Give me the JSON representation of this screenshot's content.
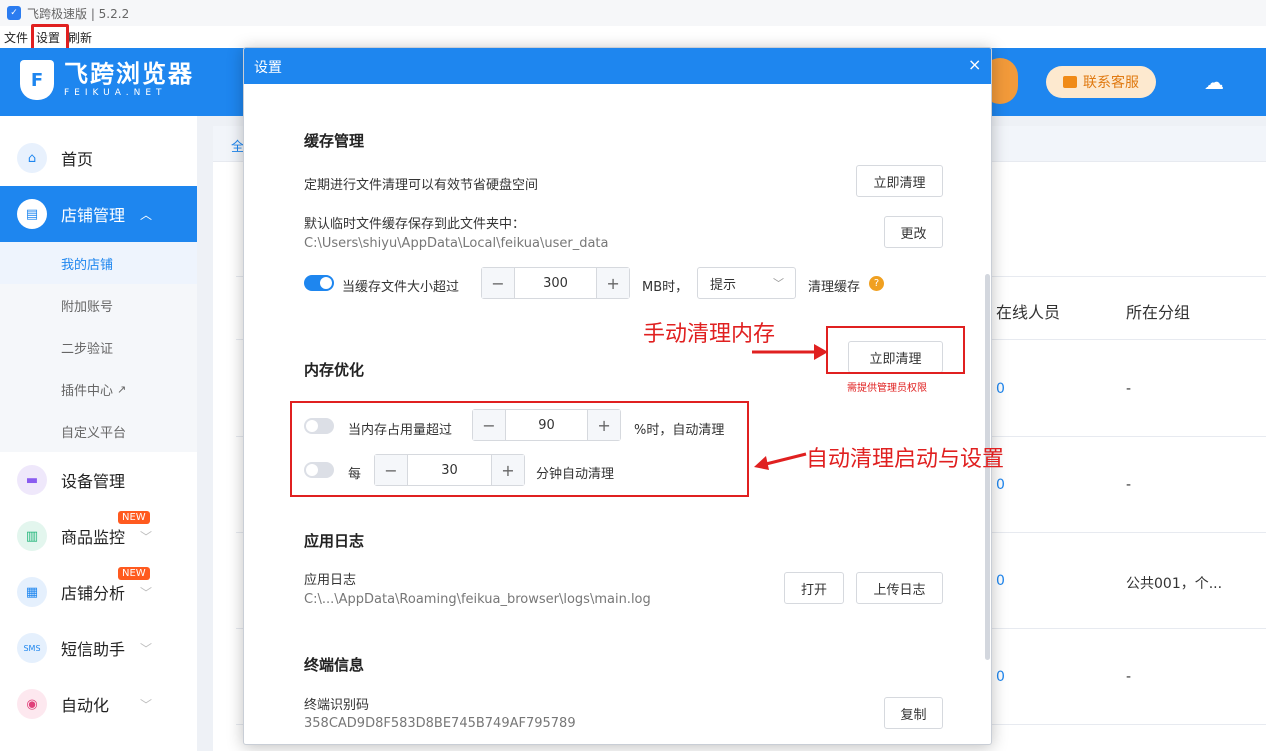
{
  "window": {
    "title": "飞跨极速版 | 5.2.2"
  },
  "menu": [
    "文件",
    "设置",
    "刷新"
  ],
  "brand": {
    "name": "飞跨浏览器",
    "sub": "FEIKUA.NET"
  },
  "header": {
    "service": "联系客服"
  },
  "sidebar": {
    "home": "首页",
    "shop": "店铺管理",
    "shop_sub": [
      "我的店铺",
      "附加账号",
      "二步验证",
      "插件中心",
      "自定义平台"
    ],
    "device": "设备管理",
    "monitor": "商品监控",
    "analysis": "店铺分析",
    "sms": "短信助手",
    "auto": "自动化",
    "new_badge": "NEW"
  },
  "background": {
    "tab": "全",
    "columns": [
      "在线人员",
      "所在分组"
    ],
    "rows": [
      {
        "online": "0",
        "group": "-"
      },
      {
        "online": "0",
        "group": "-"
      },
      {
        "online": "0",
        "group": "公共001，个..."
      },
      {
        "online": "0",
        "group": "-"
      }
    ]
  },
  "dialog": {
    "title": "设置",
    "close": "×",
    "cache": {
      "title": "缓存管理",
      "periodic": "定期进行文件清理可以有效节省硬盘空间",
      "clean_btn": "立即清理",
      "default_dir_label": "默认临时文件缓存保存到此文件夹中：",
      "default_dir_path": "C:\\Users\\shiyu\\AppData\\Local\\feikua\\user_data",
      "change_btn": "更改",
      "size_label": "当缓存文件大小超过",
      "size_value": "300",
      "size_unit": "MB时，",
      "action_select": "提示",
      "action_label": "清理缓存",
      "help": "?"
    },
    "memory": {
      "title": "内存优化",
      "clean_btn": "立即清理",
      "admin_note": "需提供管理员权限",
      "usage_label": "当内存占用量超过",
      "usage_value": "90",
      "usage_suffix": "%时，自动清理",
      "every_label": "每",
      "every_value": "30",
      "every_suffix": "分钟自动清理"
    },
    "log": {
      "title": "应用日志",
      "label": "应用日志",
      "path": "C:\\...\\AppData\\Roaming\\feikua_browser\\logs\\main.log",
      "open_btn": "打开",
      "upload_btn": "上传日志"
    },
    "terminal": {
      "title": "终端信息",
      "label": "终端识别码",
      "code": "358CAD9D8F583D8BE745B749AF795789",
      "copy_btn": "复制"
    }
  },
  "annotations": {
    "manual": "手动清理内存",
    "auto": "自动清理启动与设置"
  },
  "stepper": {
    "minus": "−",
    "plus": "+"
  },
  "colors": {
    "primary": "#1e86ef",
    "annotation": "#e02020",
    "service_bg": "#fde9cf"
  }
}
